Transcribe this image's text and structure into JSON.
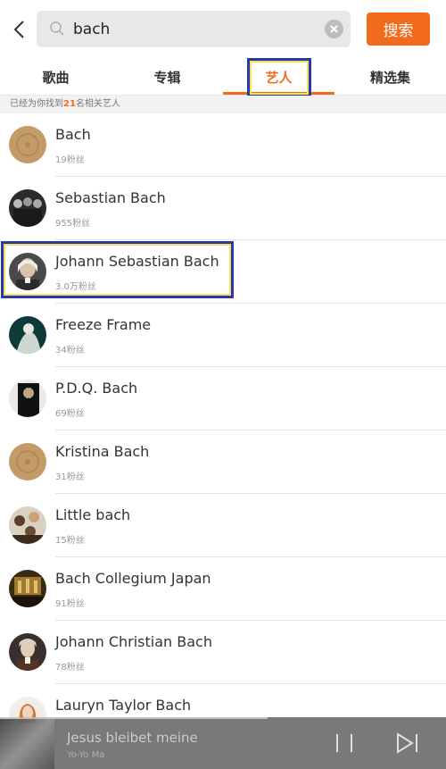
{
  "header": {
    "back_icon": "chevron-left-icon",
    "search_icon": "search-icon",
    "search_value": "bach",
    "clear_icon": "close-circle-icon",
    "search_button": "搜索"
  },
  "tabs": [
    {
      "label": "歌曲"
    },
    {
      "label": "专辑"
    },
    {
      "label": "艺人"
    },
    {
      "label": "精选集"
    }
  ],
  "active_tab": "艺人",
  "info": {
    "prefix": "已经为你找到",
    "count": "21",
    "suffix": "名相关艺人"
  },
  "artists": [
    {
      "name": "Bach",
      "fans": "19粉丝",
      "avatar": "placeholder-disc"
    },
    {
      "name": "Sebastian Bach",
      "fans": "955粉丝",
      "avatar": "band-photo"
    },
    {
      "name": "Johann Sebastian Bach",
      "fans": "3.0万粉丝",
      "avatar": "portrait"
    },
    {
      "name": "Freeze Frame",
      "fans": "34粉丝",
      "avatar": "photo"
    },
    {
      "name": "P.D.Q. Bach",
      "fans": "69粉丝",
      "avatar": "photo"
    },
    {
      "name": "Kristina Bach",
      "fans": "31粉丝",
      "avatar": "placeholder-disc"
    },
    {
      "name": "Little bach",
      "fans": "15粉丝",
      "avatar": "group-photo"
    },
    {
      "name": "Bach Collegium Japan",
      "fans": "91粉丝",
      "avatar": "hall-photo"
    },
    {
      "name": "Johann Christian Bach",
      "fans": "78粉丝",
      "avatar": "portrait"
    },
    {
      "name": "Lauryn Taylor Bach",
      "fans": "",
      "avatar": "photo"
    }
  ],
  "player": {
    "title": "Jesus bleibet meine",
    "artist": "Yo-Yo Ma",
    "progress": 0.6,
    "pause_icon": "pause-icon",
    "next_icon": "next-track-icon"
  },
  "colors": {
    "accent": "#f26b1d",
    "highlight_border": "#2b39a8",
    "highlight_inner": "#f5e15a"
  }
}
